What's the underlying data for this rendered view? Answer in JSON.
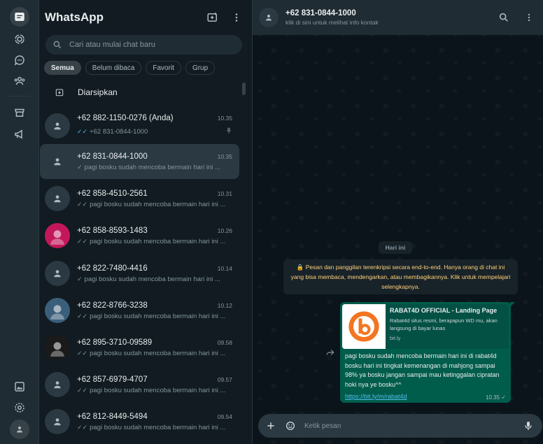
{
  "app": {
    "title": "WhatsApp"
  },
  "search": {
    "placeholder": "Cari atau mulai chat baru"
  },
  "filters": [
    "Semua",
    "Belum dibaca",
    "Favorit",
    "Grup"
  ],
  "archived": {
    "label": "Diarsipkan"
  },
  "chats": [
    {
      "name": "+62 882-1150-0276 (Anda)",
      "time": "10.35",
      "preview": "+62 831-0844-1000",
      "tick": "✓✓",
      "pinned": true
    },
    {
      "name": "+62 831-0844-1000",
      "time": "10.35",
      "preview": "pagi bosku sudah mencoba bermain hari ini ...",
      "tick": "✓"
    },
    {
      "name": "+62 858-4510-2561",
      "time": "10.31",
      "preview": "pagi bosku sudah mencoba bermain hari ini ...",
      "tick": "✓✓"
    },
    {
      "name": "+62 858-8593-1483",
      "time": "10.26",
      "preview": "pagi bosku sudah mencoba bermain hari ini ...",
      "tick": "✓✓"
    },
    {
      "name": "+62 822-7480-4416",
      "time": "10.14",
      "preview": "pagi bosku sudah mencoba bermain hari ini ...",
      "tick": "✓"
    },
    {
      "name": "+62 822-8766-3238",
      "time": "10.12",
      "preview": "pagi bosku sudah mencoba bermain hari ini ...",
      "tick": "✓✓"
    },
    {
      "name": "+62 895-3710-09589",
      "time": "09.58",
      "preview": "pagi bosku sudah mencoba bermain hari ini ...",
      "tick": "✓✓"
    },
    {
      "name": "+62 857-6979-4707",
      "time": "09.57",
      "preview": "pagi bosku sudah mencoba bermain hari ini ...",
      "tick": "✓✓"
    },
    {
      "name": "+62 812-8449-5494",
      "time": "09.54",
      "preview": "pagi bosku sudah mencoba bermain hari ini ...",
      "tick": "✓✓"
    }
  ],
  "conversation": {
    "title": "+62 831-0844-1000",
    "subtitle": "klik di sini untuk melihat info kontak",
    "day_label": "Hari ini",
    "encryption_notice": "🔒 Pesan dan panggilan terenkripsi secara end-to-end. Hanya orang di chat ini yang bisa membaca, mendengarkan, atau membagikannya. Klik untuk mempelajari selengkapnya.",
    "message": {
      "link_title": "RABAT4D OFFICIAL - Landing Page",
      "link_desc": "Rabat4d situs resmi, berapapun WD mu, akan langsung di bayar lunas",
      "link_domain": "bit.ly",
      "text": "pagi bosku sudah mencoba bermain hari ini di rabat4d bosku hari ini tingkat kemenangan di mahjong sampai 98% ya bosku jangan sampai mau ketinggalan cipratan hoki nya ye bosku^^",
      "url": "https://bit.ly/m/rabat4d",
      "time": "10.35",
      "tick": "✓"
    },
    "composer_placeholder": "Ketik pesan"
  },
  "colors": {
    "accent": "#00a884",
    "bubble_out": "#005c4b",
    "notice_text": "#ffd279",
    "link": "#53bdeb"
  }
}
